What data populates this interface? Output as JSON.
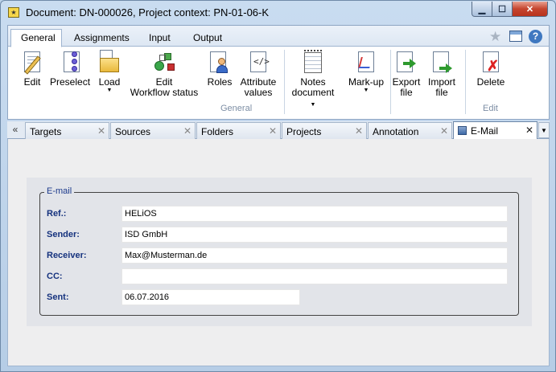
{
  "window": {
    "title": "Document: DN-000026, Project context: PN-01-06-K",
    "controls": {
      "minimize": "▁",
      "maximize": "☐",
      "close": "✕"
    }
  },
  "ribbon": {
    "tabs": [
      "General",
      "Assignments",
      "Input",
      "Output"
    ],
    "active_tab": "General",
    "right_icons": [
      "star-icon",
      "window-icon",
      "help-icon"
    ],
    "help_label": "?",
    "buttons": {
      "edit": "Edit",
      "preselect": "Preselect",
      "load": "Load",
      "edit_workflow_1": "Edit",
      "edit_workflow_2": "Workflow status",
      "roles": "Roles",
      "attribute_values_1": "Attribute",
      "attribute_values_2": "values",
      "notes_document_1": "Notes",
      "notes_document_2": "document",
      "markup": "Mark-up",
      "export_file_1": "Export",
      "export_file_2": "file",
      "import_file_1": "Import",
      "import_file_2": "file",
      "delete": "Delete"
    },
    "groups": {
      "general": "General",
      "edit": "Edit"
    }
  },
  "doc_tabs": {
    "scroll_left": "«",
    "tabs": [
      "Targets",
      "Sources",
      "Folders",
      "Projects",
      "Annotation",
      "E-Mail"
    ],
    "active": "E-Mail",
    "close_glyph": "✕"
  },
  "email": {
    "legend": "E-mail",
    "fields": [
      {
        "label": "Ref.:",
        "value": "HELiOS"
      },
      {
        "label": "Sender:",
        "value": "ISD GmbH"
      },
      {
        "label": "Receiver:",
        "value": "Max@Musterman.de"
      },
      {
        "label": "CC:",
        "value": ""
      },
      {
        "label": "Sent:",
        "value": "06.07.2016"
      }
    ]
  }
}
